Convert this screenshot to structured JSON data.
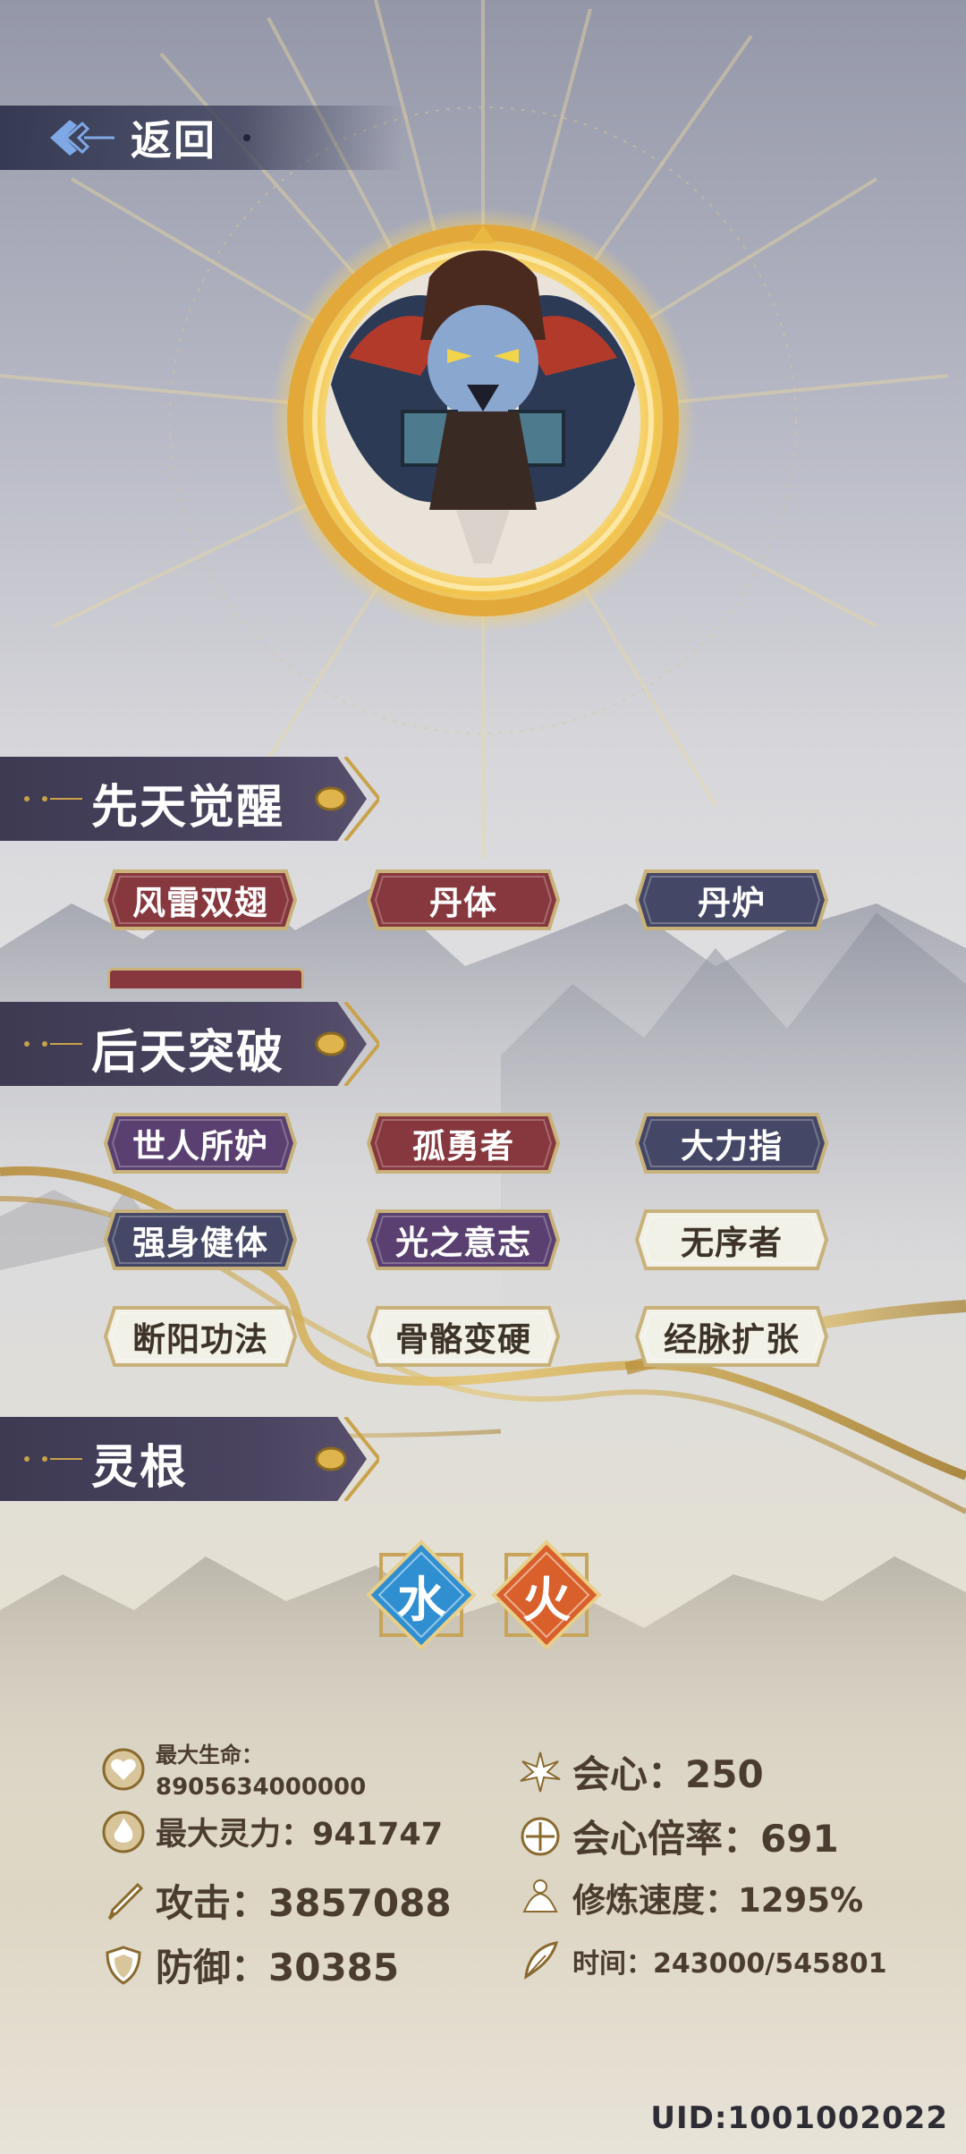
{
  "back_button": {
    "label": "返回"
  },
  "sections": {
    "innate": {
      "title": "先天觉醒"
    },
    "acquired": {
      "title": "后天突破"
    },
    "spirit_root": {
      "title": "灵根"
    }
  },
  "innate_tags": [
    {
      "label": "风雷双翅",
      "style": "red"
    },
    {
      "label": "丹体",
      "style": "red"
    },
    {
      "label": "丹炉",
      "style": "navy"
    }
  ],
  "acquired_tags": [
    {
      "label": "世人所妒",
      "style": "purple"
    },
    {
      "label": "孤勇者",
      "style": "red"
    },
    {
      "label": "大力指",
      "style": "navy"
    },
    {
      "label": "强身健体",
      "style": "navy"
    },
    {
      "label": "光之意志",
      "style": "purple"
    },
    {
      "label": "无序者",
      "style": "white"
    },
    {
      "label": "断阳功法",
      "style": "white"
    },
    {
      "label": "骨骼变硬",
      "style": "white"
    },
    {
      "label": "经脉扩张",
      "style": "white"
    }
  ],
  "spirit_roots": [
    {
      "glyph": "水",
      "element": "water",
      "color": "#2f8fd1"
    },
    {
      "glyph": "火",
      "element": "fire",
      "color": "#d9602a"
    }
  ],
  "stats": {
    "max_hp_label": "最大生命：",
    "max_hp_value": "8905634000000",
    "max_spirit": "最大灵力：941747",
    "attack": "攻击：3857088",
    "defense": "防御：30385",
    "crit": "会心：250",
    "crit_mult": "会心倍率：691",
    "cultivation_speed": "修炼速度：1295%",
    "time": "时间：243000/545801"
  },
  "uid": "UID:1001002022",
  "colors": {
    "tag_red": "#86383e",
    "tag_navy": "#444866",
    "tag_purple": "#5a4070",
    "tag_white": "#f2f1e8",
    "gold": "#c9a24a",
    "section_bar": "#443f58"
  }
}
